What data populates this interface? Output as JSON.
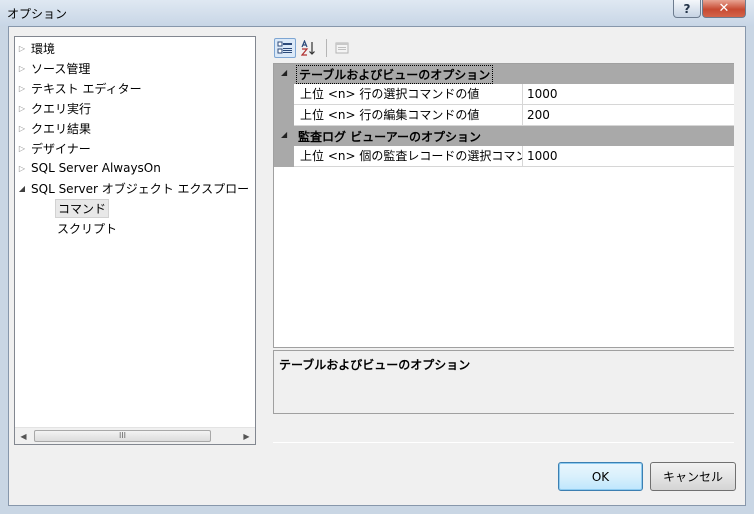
{
  "window": {
    "title": "オプション",
    "help_glyph": "?",
    "close_glyph": "✕"
  },
  "tree": {
    "items": [
      {
        "label": "環境",
        "expander": "collapsed"
      },
      {
        "label": "ソース管理",
        "expander": "collapsed"
      },
      {
        "label": "テキスト エディター",
        "expander": "collapsed"
      },
      {
        "label": "クエリ実行",
        "expander": "collapsed"
      },
      {
        "label": "クエリ結果",
        "expander": "collapsed"
      },
      {
        "label": "デザイナー",
        "expander": "collapsed"
      },
      {
        "label": "SQL Server AlwaysOn",
        "expander": "collapsed"
      },
      {
        "label": "SQL Server オブジェクト エクスプロー",
        "expander": "expanded"
      }
    ],
    "children": [
      {
        "label": "コマンド",
        "selected": true
      },
      {
        "label": "スクリプト",
        "selected": false
      }
    ],
    "scroll_grip": "III"
  },
  "toolbar": {
    "buttons": [
      {
        "icon": "categorized-icon",
        "active": true
      },
      {
        "icon": "alphabetical-sort-icon",
        "active": false
      },
      {
        "icon": "property-pages-icon",
        "active": false,
        "disabled": true
      }
    ]
  },
  "property_grid": {
    "categories": [
      {
        "label": "テーブルおよびビューのオプション",
        "properties": [
          {
            "name": "上位 <n> 行の選択コマンドの値",
            "value": "1000"
          },
          {
            "name": "上位 <n> 行の編集コマンドの値",
            "value": "200"
          }
        ]
      },
      {
        "label": "監査ログ ビューアーのオプション",
        "properties": [
          {
            "name": "上位 <n> 個の監査レコードの選択コマン",
            "value": "1000"
          }
        ]
      }
    ]
  },
  "description": {
    "title": "テーブルおよびビューのオプション"
  },
  "buttons": {
    "ok": "OK",
    "cancel": "キャンセル"
  },
  "colors": {
    "category_band": "#a9a9a9",
    "ok_border": "#3c7fb1",
    "close_red": "#c74a32"
  }
}
